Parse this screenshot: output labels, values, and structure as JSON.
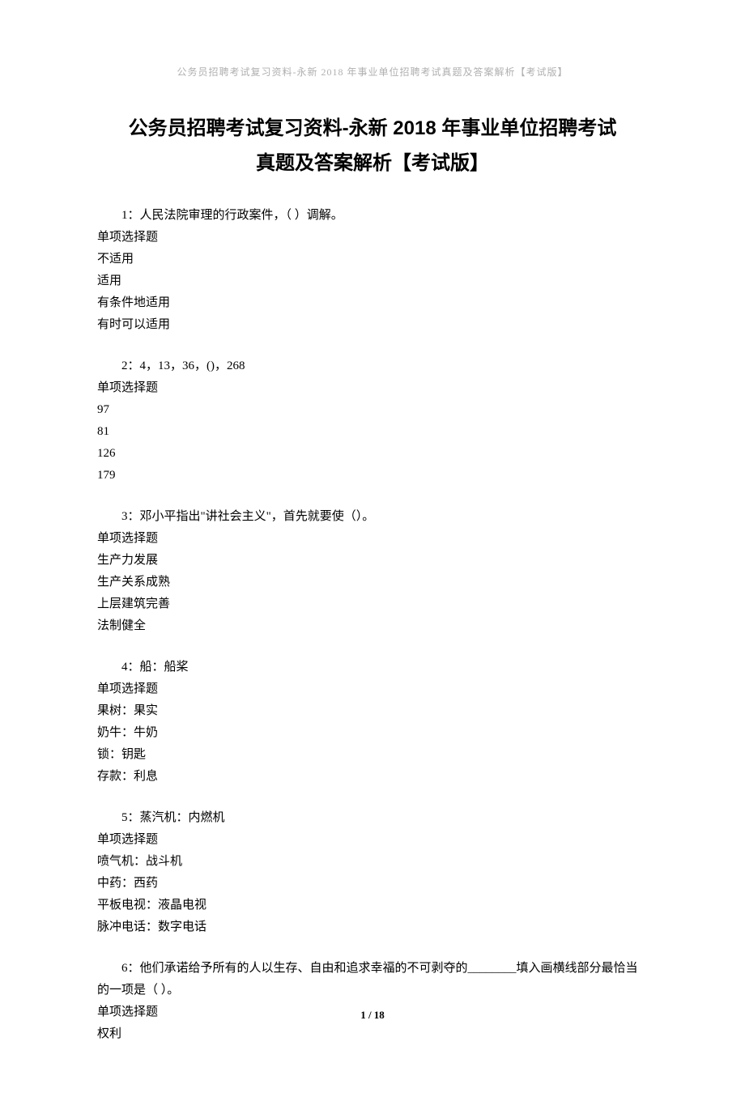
{
  "header": "公务员招聘考试复习资料-永新 2018 年事业单位招聘考试真题及答案解析【考试版】",
  "title_line1": "公务员招聘考试复习资料-永新 2018 年事业单位招聘考试",
  "title_line2": "真题及答案解析【考试版】",
  "questions": [
    {
      "text": "1：人民法院审理的行政案件，（ ）调解。",
      "type": "单项选择题",
      "options": [
        "不适用",
        "适用",
        "有条件地适用",
        "有时可以适用"
      ]
    },
    {
      "text": "2：4，13，36，()，268",
      "type": "单项选择题",
      "options": [
        "97",
        "81",
        "126",
        "179"
      ]
    },
    {
      "text": "3：邓小平指出\"讲社会主义\"，首先就要使（）。",
      "type": "单项选择题",
      "options": [
        "生产力发展",
        "生产关系成熟",
        "上层建筑完善",
        "法制健全"
      ]
    },
    {
      "text": "4：船：船桨",
      "type": "单项选择题",
      "options": [
        "果树：果实",
        "奶牛：牛奶",
        "锁：钥匙",
        "存款：利息"
      ]
    },
    {
      "text": "5：蒸汽机：内燃机",
      "type": "单项选择题",
      "options": [
        "喷气机：战斗机",
        "中药：西药",
        "平板电视：液晶电视",
        "脉冲电话：数字电话"
      ]
    },
    {
      "text": "6：他们承诺给予所有的人以生存、自由和追求幸福的不可剥夺的________填入画横线部分最恰当的一项是（  ）。",
      "type": "单项选择题",
      "options": [
        "权利"
      ]
    }
  ],
  "page_number": "1 / 18"
}
